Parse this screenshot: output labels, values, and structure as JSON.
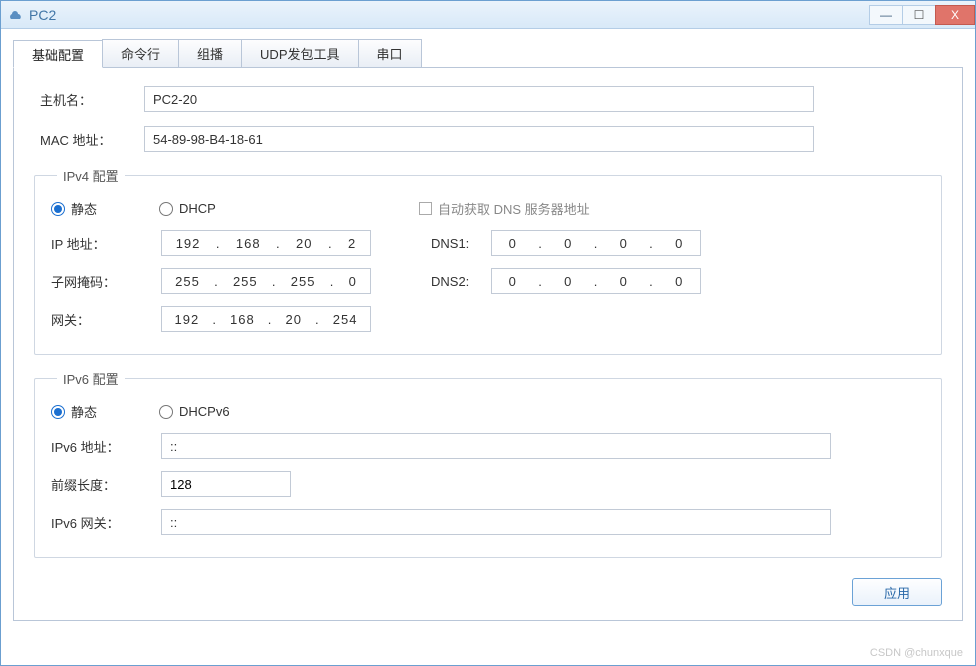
{
  "window": {
    "title": "PC2"
  },
  "tabs": [
    {
      "label": "基础配置",
      "active": true
    },
    {
      "label": "命令行",
      "active": false
    },
    {
      "label": "组播",
      "active": false
    },
    {
      "label": "UDP发包工具",
      "active": false
    },
    {
      "label": "串口",
      "active": false
    }
  ],
  "basic": {
    "hostname_label": "主机名：",
    "hostname_value": "PC2-20",
    "mac_label": "MAC 地址：",
    "mac_value": "54-89-98-B4-18-61"
  },
  "ipv4": {
    "legend": "IPv4 配置",
    "radio_static": "静态",
    "radio_dhcp": "DHCP",
    "auto_dns_label": "自动获取 DNS 服务器地址",
    "ip_label": "IP 地址：",
    "mask_label": "子网掩码：",
    "gw_label": "网关：",
    "dns1_label": "DNS1:",
    "dns2_label": "DNS2:",
    "ip": [
      "192",
      "168",
      "20",
      "2"
    ],
    "mask": [
      "255",
      "255",
      "255",
      "0"
    ],
    "gw": [
      "192",
      "168",
      "20",
      "254"
    ],
    "dns1": [
      "0",
      "0",
      "0",
      "0"
    ],
    "dns2": [
      "0",
      "0",
      "0",
      "0"
    ]
  },
  "ipv6": {
    "legend": "IPv6 配置",
    "radio_static": "静态",
    "radio_dhcpv6": "DHCPv6",
    "addr_label": "IPv6 地址：",
    "addr_value": "::",
    "prefix_label": "前缀长度：",
    "prefix_value": "128",
    "gw_label": "IPv6 网关：",
    "gw_value": "::"
  },
  "actions": {
    "apply": "应用"
  },
  "watermark": "CSDN @chunxque"
}
